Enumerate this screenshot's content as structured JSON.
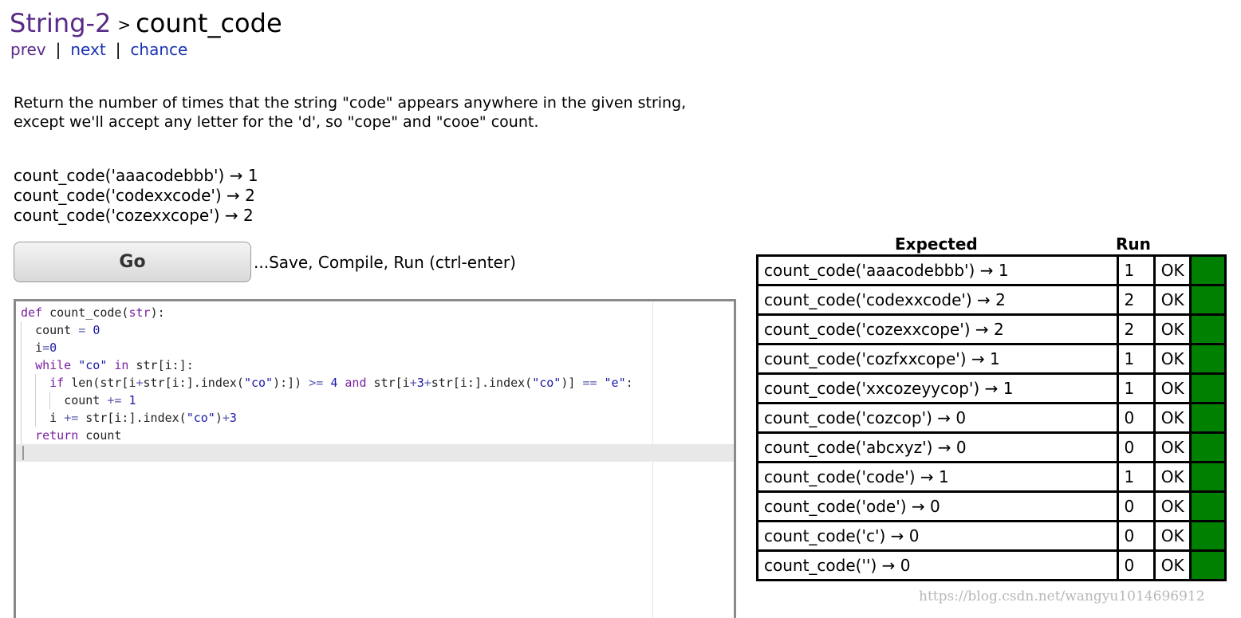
{
  "header": {
    "section": "String-2",
    "separator": ">",
    "problem": "count_code"
  },
  "nav": {
    "prev": "prev",
    "sep": "|",
    "next": "next",
    "chance": "chance"
  },
  "description": {
    "line1": "Return the number of times that the string \"code\" appears anywhere in the given string,",
    "line2": "except we'll accept any letter for the 'd', so \"cope\" and \"cooe\" count."
  },
  "examples": [
    "count_code('aaacodebbb') → 1",
    "count_code('codexxcode') → 2",
    "count_code('cozexxcope') → 2"
  ],
  "go": {
    "label": "Go",
    "hint": "...Save, Compile, Run (ctrl-enter)"
  },
  "editor": {
    "l1_def": "def",
    "l1_rest": " count_code(",
    "l1_arg": "str",
    "l1_end": "):",
    "l2_name": "count",
    "l2_op": " = ",
    "l2_num": "0",
    "l3_name": "i",
    "l3_op": "=",
    "l3_num": "0",
    "l4_kw": "while",
    "l4_str": "\"co\"",
    "l4_in": "in",
    "l4_rest": "str[i:]:",
    "l5_if": "if",
    "l5_a": "len(str[i",
    "l5_plus1": "+",
    "l5_b": "str[i:].index(",
    "l5_co1": "\"co\"",
    "l5_c": "):])",
    "l5_ge": ">=",
    "l5_four": "4",
    "l5_and": "and",
    "l5_d": "str[i",
    "l5_plus2": "+",
    "l5_three": "3",
    "l5_plus3": "+",
    "l5_e": "str[i:].index(",
    "l5_co2": "\"co\"",
    "l5_f": ")]",
    "l5_eq": "==",
    "l5_estr": "\"e\"",
    "l5_colon": ":",
    "l6_name": "count",
    "l6_op": "+=",
    "l6_num": "1",
    "l7_name": "i",
    "l7_op": "+=",
    "l7_a": "str[i:].index(",
    "l7_co": "\"co\"",
    "l7_b": ")",
    "l7_plus": "+",
    "l7_num": "3",
    "l8_kw": "return",
    "l8_name": "count"
  },
  "results": {
    "expected_header": "Expected",
    "run_header": "Run",
    "pass_color": "#008000",
    "rows": [
      {
        "expected": "count_code('aaacodebbb') → 1",
        "run": "1",
        "status": "OK"
      },
      {
        "expected": "count_code('codexxcode') → 2",
        "run": "2",
        "status": "OK"
      },
      {
        "expected": "count_code('cozexxcope') → 2",
        "run": "2",
        "status": "OK"
      },
      {
        "expected": "count_code('cozfxxcope') → 1",
        "run": "1",
        "status": "OK"
      },
      {
        "expected": "count_code('xxcozeyycop') → 1",
        "run": "1",
        "status": "OK"
      },
      {
        "expected": "count_code('cozcop') → 0",
        "run": "0",
        "status": "OK"
      },
      {
        "expected": "count_code('abcxyz') → 0",
        "run": "0",
        "status": "OK"
      },
      {
        "expected": "count_code('code') → 1",
        "run": "1",
        "status": "OK"
      },
      {
        "expected": "count_code('ode') → 0",
        "run": "0",
        "status": "OK"
      },
      {
        "expected": "count_code('c') → 0",
        "run": "0",
        "status": "OK"
      },
      {
        "expected": "count_code('') → 0",
        "run": "0",
        "status": "OK"
      }
    ]
  },
  "watermark": "https://blog.csdn.net/wangyu1014696912"
}
